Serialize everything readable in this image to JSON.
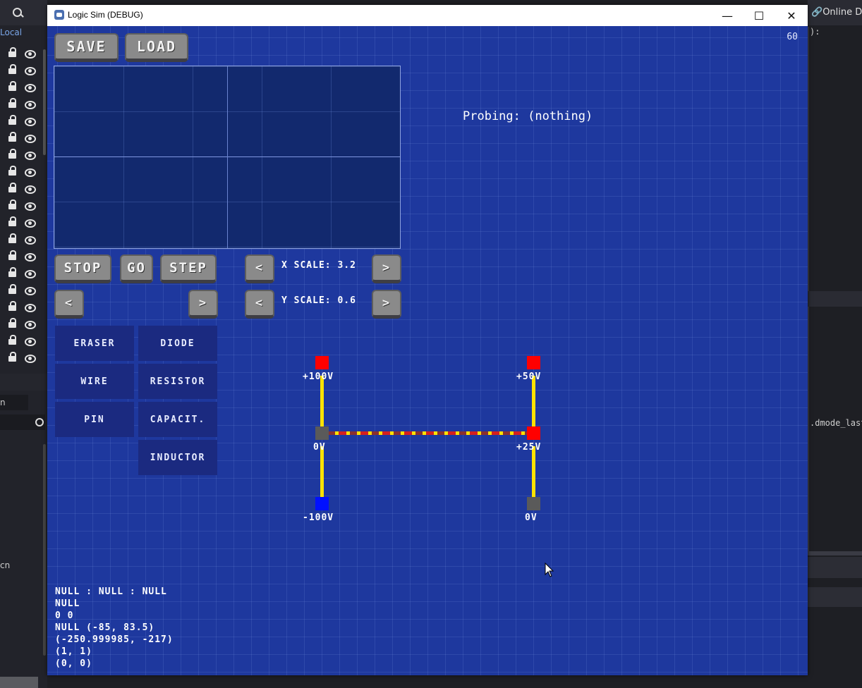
{
  "window": {
    "title": "Logic Sim (DEBUG)",
    "controls": {
      "minimize": "—",
      "maximize": "☐",
      "close": "✕"
    }
  },
  "editor_bg": {
    "left_tab": "Local",
    "left_filter_text": "n",
    "left_bottom_text": "cn",
    "right_link": "Online Do",
    "right_code_top": "):",
    "right_code_mid": ".dmode_last_"
  },
  "fps": "60",
  "toolbar": {
    "save_label": "SAVE",
    "load_label": "LOAD"
  },
  "sim_controls": {
    "stop_label": "STOP",
    "go_label": "GO",
    "step_label": "STEP",
    "prev_label": "<",
    "next_label": ">"
  },
  "scale": {
    "x_label": "X SCALE: 3.2",
    "y_label": "Y SCALE: 0.6",
    "dec_label": "<",
    "inc_label": ">"
  },
  "probing_text": "Probing: (nothing)",
  "tools": {
    "eraser": "ERASER",
    "wire": "WIRE",
    "pin": "PIN",
    "diode": "DIODE",
    "resistor": "RESISTOR",
    "capacitor": "CAPACIT.",
    "inductor": "INDUCTOR"
  },
  "circuit": {
    "nodes": [
      {
        "name": "pin-top-left",
        "label": "+100V",
        "color": "#ff0000"
      },
      {
        "name": "pin-top-right",
        "label": "+50V",
        "color": "#ff0000"
      },
      {
        "name": "pin-mid-left",
        "label": "0V",
        "color": "#5a5a5a"
      },
      {
        "name": "pin-mid-right",
        "label": "+25V",
        "color": "#ff0000"
      },
      {
        "name": "pin-bottom-left",
        "label": "-100V",
        "color": "#0010ff"
      },
      {
        "name": "pin-bottom-right",
        "label": "0V",
        "color": "#5a5a5a"
      }
    ],
    "wire_color": "#ffe200",
    "resistor_color": "#d42020"
  },
  "debug_lines": [
    "NULL : NULL : NULL",
    "NULL",
    "0 0",
    "NULL (-85, 83.5)",
    "(-250.999985, -217)",
    "(1, 1)",
    "(0, 0)"
  ]
}
